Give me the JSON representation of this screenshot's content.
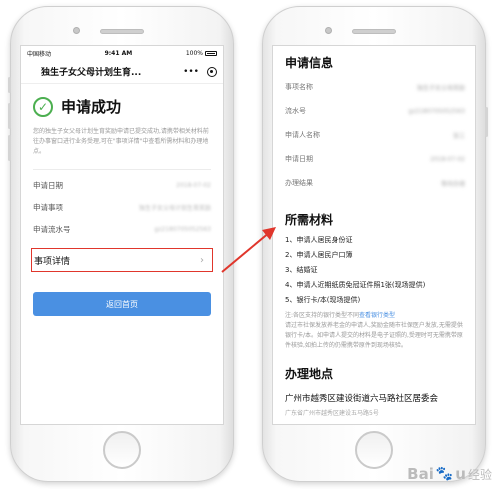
{
  "left_phone": {
    "status": {
      "carrier": "中国移动",
      "time": "9:41 AM",
      "battery": "100%"
    },
    "nav": {
      "title": "独生子女父母计划生育...",
      "more_icon": "•••"
    },
    "success_title": "申请成功",
    "description": "您的独生子女父母计划生育奖励申请已提交成功,请携带相关材料前往办事窗口进行业务受理,可在\"事项详情\"中查看所需材料和办理地点。",
    "rows": [
      {
        "label": "申请日期",
        "value": "2018-07-02"
      },
      {
        "label": "申请事项",
        "value": "独生子女父母计划生育奖励"
      },
      {
        "label": "申请流水号",
        "value": "gz2180705052563"
      }
    ],
    "detail_label": "事项详情",
    "home_button_label": "返回首页"
  },
  "right_phone": {
    "info_title": "申请信息",
    "info_rows": [
      {
        "label": "事项名称",
        "value": "独生子女父母奖励"
      },
      {
        "label": "流水号",
        "value": "gz2180705052563"
      },
      {
        "label": "申请人名称",
        "value": "张三"
      },
      {
        "label": "申请日期",
        "value": "2018-07-02"
      },
      {
        "label": "办理结果",
        "value": "等待办理"
      }
    ],
    "materials_title": "所需材料",
    "materials": [
      "1、申请人居民身份证",
      "2、申请人居民户口簿",
      "3、结婚证",
      "4、申请人近期纸质免冠证件照1张(现场提供)",
      "5、银行卡/本(现场提供)"
    ],
    "note_prefix": "注:各区支持的银行类型不同",
    "note_link": "查看银行类型",
    "note_body": "请过市社保发放养老金的申请人,奖励金随市社保医户发放,无需提供银行卡/本。如申请人提交的材料是电子证照的,受理时可无需携带原件核验,如拍上传的仍需携带原件到现场核验。",
    "address_title": "办理地点",
    "address": "广州市越秀区建设街道六马路社区居委会",
    "address_sub": "广东省广州市越秀区建设五马路5号"
  },
  "watermark": {
    "brand": "Bai",
    "brand_end": "u",
    "suffix": "经验"
  },
  "colors": {
    "accent_blue": "#4a90e2",
    "success_green": "#4caf50",
    "highlight_red": "#e0362c"
  }
}
